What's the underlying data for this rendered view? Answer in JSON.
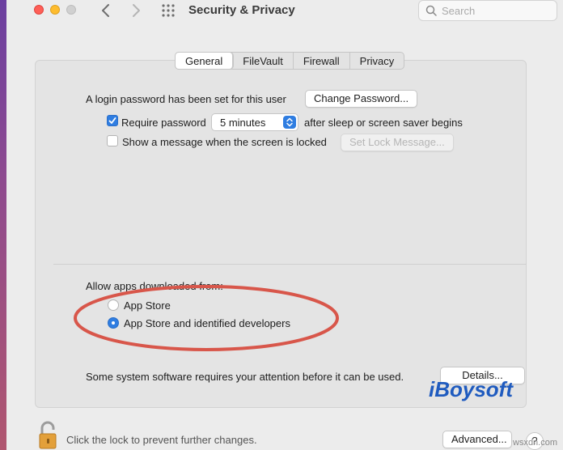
{
  "window": {
    "title": "Security & Privacy",
    "search_placeholder": "Search"
  },
  "tabs": [
    {
      "label": "General",
      "active": true
    },
    {
      "label": "FileVault",
      "active": false
    },
    {
      "label": "Firewall",
      "active": false
    },
    {
      "label": "Privacy",
      "active": false
    }
  ],
  "general": {
    "login_text": "A login password has been set for this user",
    "change_password_label": "Change Password...",
    "require_password": {
      "checked": true,
      "label": "Require password",
      "interval_value": "5 minutes",
      "suffix": "after sleep or screen saver begins"
    },
    "show_message": {
      "checked": false,
      "label": "Show a message when the screen is locked",
      "button_label": "Set Lock Message..."
    },
    "allow_apps": {
      "heading": "Allow apps downloaded from:",
      "options": [
        {
          "label": "App Store",
          "selected": false
        },
        {
          "label": "App Store and identified developers",
          "selected": true
        }
      ]
    },
    "attention_text": "Some system software requires your attention before it can be used.",
    "details_label": "Details..."
  },
  "footer": {
    "lock_text": "Click the lock to prevent further changes.",
    "advanced_label": "Advanced...",
    "help_label": "?"
  },
  "overlays": {
    "watermark_text": "iBoysoft",
    "site_text": "wsxdn.com"
  },
  "colors": {
    "accent": "#2f7de1",
    "annotation_ring": "#d8564a",
    "watermark": "#1f5bbf"
  },
  "icons": [
    "chevron-left-icon",
    "chevron-right-icon",
    "grid-icon",
    "search-icon",
    "lock-open-icon",
    "stepper-arrows-icon",
    "checkmark-icon"
  ]
}
